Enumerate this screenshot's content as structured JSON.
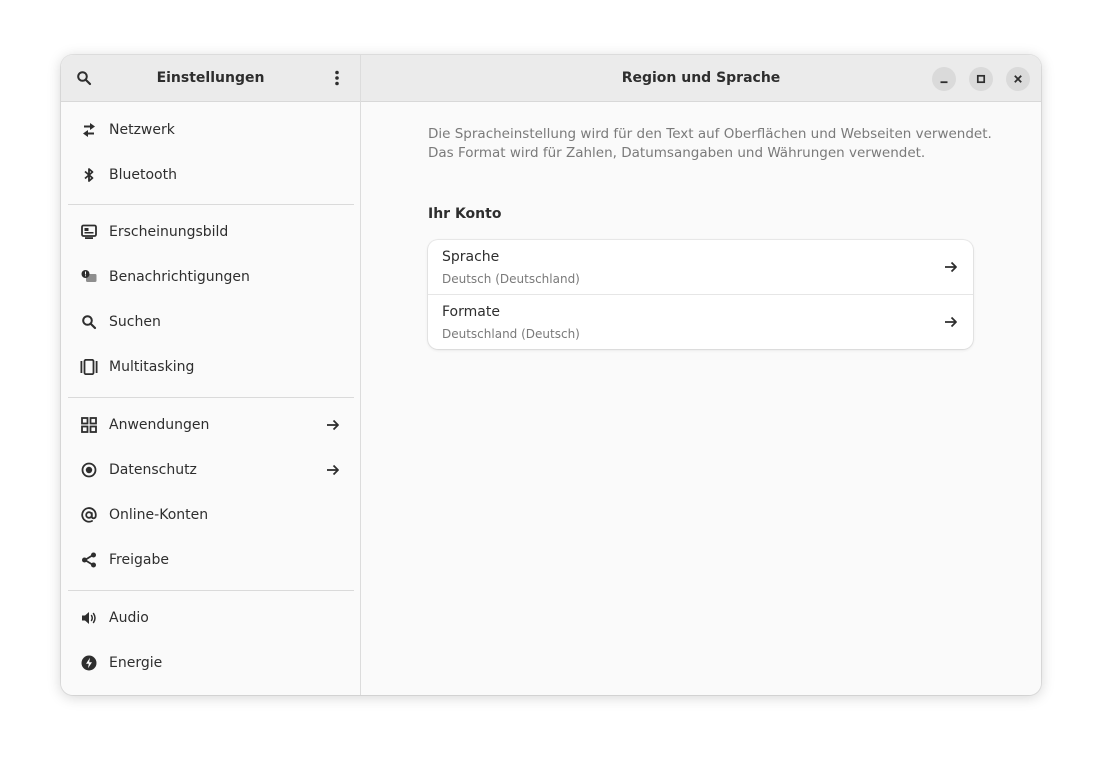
{
  "sidebar": {
    "title": "Einstellungen",
    "search_icon": "search-icon",
    "menu_icon": "kebab-menu-icon",
    "items": [
      {
        "label": "Netzwerk",
        "icon": "network-icon"
      },
      {
        "label": "Bluetooth",
        "icon": "bluetooth-icon"
      },
      {
        "label": "Erscheinungsbild",
        "icon": "appearance-icon"
      },
      {
        "label": "Benachrichtigungen",
        "icon": "notifications-icon"
      },
      {
        "label": "Suchen",
        "icon": "search-icon"
      },
      {
        "label": "Multitasking",
        "icon": "multitasking-icon"
      },
      {
        "label": "Anwendungen",
        "icon": "apps-grid-icon",
        "has_arrow": true
      },
      {
        "label": "Datenschutz",
        "icon": "privacy-icon",
        "has_arrow": true
      },
      {
        "label": "Online-Konten",
        "icon": "at-sign-icon"
      },
      {
        "label": "Freigabe",
        "icon": "share-icon"
      },
      {
        "label": "Audio",
        "icon": "speaker-icon"
      },
      {
        "label": "Energie",
        "icon": "power-icon"
      }
    ]
  },
  "main": {
    "title": "Region und Sprache",
    "description": [
      "Die Spracheinstellung wird für den Text auf Oberflächen und Webseiten verwendet.",
      "Das Format wird für Zahlen, Datumsangaben und Währungen verwendet."
    ],
    "section_title": "Ihr Konto",
    "rows": [
      {
        "title": "Sprache",
        "subtitle": "Deutsch (Deutschland)"
      },
      {
        "title": "Formate",
        "subtitle": "Deutschland (Deutsch)"
      }
    ]
  },
  "window_controls": [
    "minimize-icon",
    "maximize-icon",
    "close-icon"
  ],
  "colors": {
    "header_bg": "#ebebeb",
    "window_bg": "#fafafa",
    "card_bg": "#ffffff",
    "text": "#2e2e2e",
    "muted_text": "#7a7a7a"
  }
}
